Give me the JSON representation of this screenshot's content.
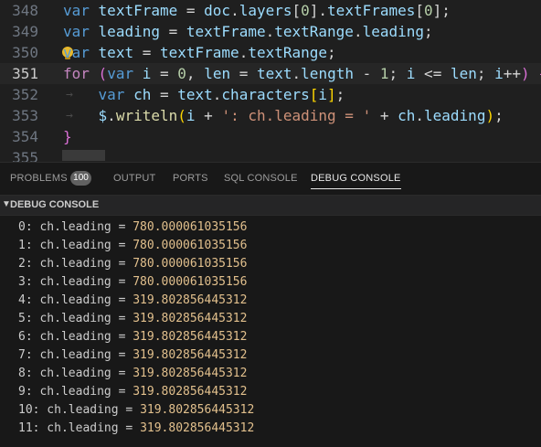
{
  "editor": {
    "lines": [
      {
        "n": "348",
        "active": false,
        "tokens": [
          {
            "t": "var",
            "c": "kw"
          },
          {
            "t": " ",
            "c": "pun"
          },
          {
            "t": "textFrame",
            "c": "var"
          },
          {
            "t": " = ",
            "c": "pun"
          },
          {
            "t": "doc",
            "c": "var"
          },
          {
            "t": ".",
            "c": "pun"
          },
          {
            "t": "layers",
            "c": "var"
          },
          {
            "t": "[",
            "c": "pun"
          },
          {
            "t": "0",
            "c": "num"
          },
          {
            "t": "].",
            "c": "pun"
          },
          {
            "t": "textFrames",
            "c": "var"
          },
          {
            "t": "[",
            "c": "pun"
          },
          {
            "t": "0",
            "c": "num"
          },
          {
            "t": "];",
            "c": "pun"
          }
        ]
      },
      {
        "n": "349",
        "active": false,
        "tokens": [
          {
            "t": "var",
            "c": "kw"
          },
          {
            "t": " ",
            "c": "pun"
          },
          {
            "t": "leading",
            "c": "var"
          },
          {
            "t": " = ",
            "c": "pun"
          },
          {
            "t": "textFrame",
            "c": "var"
          },
          {
            "t": ".",
            "c": "pun"
          },
          {
            "t": "textRange",
            "c": "var"
          },
          {
            "t": ".",
            "c": "pun"
          },
          {
            "t": "leading",
            "c": "var"
          },
          {
            "t": ";",
            "c": "pun"
          }
        ]
      },
      {
        "n": "350",
        "active": false,
        "bulb": true,
        "tokens": [
          {
            "t": "var",
            "c": "kw"
          },
          {
            "t": " ",
            "c": "pun"
          },
          {
            "t": "text",
            "c": "var"
          },
          {
            "t": " = ",
            "c": "pun"
          },
          {
            "t": "textFrame",
            "c": "var"
          },
          {
            "t": ".",
            "c": "pun"
          },
          {
            "t": "textRange",
            "c": "var"
          },
          {
            "t": ";",
            "c": "pun"
          }
        ]
      },
      {
        "n": "351",
        "active": true,
        "tokens": [
          {
            "t": "for",
            "c": "kw2"
          },
          {
            "t": " ",
            "c": "pun"
          },
          {
            "t": "(",
            "c": "br2"
          },
          {
            "t": "var",
            "c": "kw"
          },
          {
            "t": " ",
            "c": "pun"
          },
          {
            "t": "i",
            "c": "var"
          },
          {
            "t": " = ",
            "c": "pun"
          },
          {
            "t": "0",
            "c": "num"
          },
          {
            "t": ", ",
            "c": "pun"
          },
          {
            "t": "len",
            "c": "var"
          },
          {
            "t": " = ",
            "c": "pun"
          },
          {
            "t": "text",
            "c": "var"
          },
          {
            "t": ".",
            "c": "pun"
          },
          {
            "t": "length",
            "c": "var"
          },
          {
            "t": " - ",
            "c": "pun"
          },
          {
            "t": "1",
            "c": "num"
          },
          {
            "t": "; ",
            "c": "pun"
          },
          {
            "t": "i",
            "c": "var"
          },
          {
            "t": " <= ",
            "c": "pun"
          },
          {
            "t": "len",
            "c": "var"
          },
          {
            "t": "; ",
            "c": "pun"
          },
          {
            "t": "i",
            "c": "var"
          },
          {
            "t": "++",
            "c": "pun"
          },
          {
            "t": ")",
            "c": "br2"
          },
          {
            "t": " ",
            "c": "pun"
          },
          {
            "t": "{",
            "c": "br2"
          }
        ]
      },
      {
        "n": "352",
        "active": false,
        "indent": true,
        "tokens": [
          {
            "t": "    ",
            "c": "pun"
          },
          {
            "t": "var",
            "c": "kw"
          },
          {
            "t": " ",
            "c": "pun"
          },
          {
            "t": "ch",
            "c": "var"
          },
          {
            "t": " = ",
            "c": "pun"
          },
          {
            "t": "text",
            "c": "var"
          },
          {
            "t": ".",
            "c": "pun"
          },
          {
            "t": "characters",
            "c": "var"
          },
          {
            "t": "[",
            "c": "br1"
          },
          {
            "t": "i",
            "c": "var"
          },
          {
            "t": "]",
            "c": "br1"
          },
          {
            "t": ";",
            "c": "pun"
          }
        ]
      },
      {
        "n": "353",
        "active": false,
        "indent": true,
        "tokens": [
          {
            "t": "    ",
            "c": "pun"
          },
          {
            "t": "$",
            "c": "var"
          },
          {
            "t": ".",
            "c": "pun"
          },
          {
            "t": "writeln",
            "c": "fn"
          },
          {
            "t": "(",
            "c": "br1"
          },
          {
            "t": "i",
            "c": "var"
          },
          {
            "t": " + ",
            "c": "pun"
          },
          {
            "t": "': ch.leading = '",
            "c": "str"
          },
          {
            "t": " + ",
            "c": "pun"
          },
          {
            "t": "ch",
            "c": "var"
          },
          {
            "t": ".",
            "c": "pun"
          },
          {
            "t": "leading",
            "c": "var"
          },
          {
            "t": ")",
            "c": "br1"
          },
          {
            "t": ";",
            "c": "pun"
          }
        ]
      },
      {
        "n": "354",
        "active": false,
        "tokens": [
          {
            "t": "}",
            "c": "br2"
          }
        ]
      },
      {
        "n": "355",
        "active": false,
        "tokens": []
      }
    ]
  },
  "panel": {
    "tabs": [
      {
        "label": "PROBLEMS",
        "active": false
      },
      {
        "label": "OUTPUT",
        "active": false
      },
      {
        "label": "PORTS",
        "active": false
      },
      {
        "label": "SQL CONSOLE",
        "active": false
      },
      {
        "label": "DEBUG CONSOLE",
        "active": true
      }
    ],
    "problems_count": "100",
    "section_title": "DEBUG CONSOLE",
    "section_icon": "chevron-down-icon",
    "output": [
      {
        "prefix": "0: ch.leading = ",
        "value": "780.000061035156"
      },
      {
        "prefix": "1: ch.leading = ",
        "value": "780.000061035156"
      },
      {
        "prefix": "2: ch.leading = ",
        "value": "780.000061035156"
      },
      {
        "prefix": "3: ch.leading = ",
        "value": "780.000061035156"
      },
      {
        "prefix": "4: ch.leading = ",
        "value": "319.802856445312"
      },
      {
        "prefix": "5: ch.leading = ",
        "value": "319.802856445312"
      },
      {
        "prefix": "6: ch.leading = ",
        "value": "319.802856445312"
      },
      {
        "prefix": "7: ch.leading = ",
        "value": "319.802856445312"
      },
      {
        "prefix": "8: ch.leading = ",
        "value": "319.802856445312"
      },
      {
        "prefix": "9: ch.leading = ",
        "value": "319.802856445312"
      },
      {
        "prefix": "10: ch.leading = ",
        "value": "319.802856445312"
      },
      {
        "prefix": "11: ch.leading = ",
        "value": "319.802856445312"
      }
    ]
  },
  "colors": {
    "keyword": "#569cd6",
    "control": "#c586c0",
    "variable": "#9cdcfe",
    "function": "#dcdcaa",
    "number": "#b5cea8",
    "string": "#ce9178",
    "output_value": "#e2c08d",
    "background": "#1f1f1f"
  }
}
